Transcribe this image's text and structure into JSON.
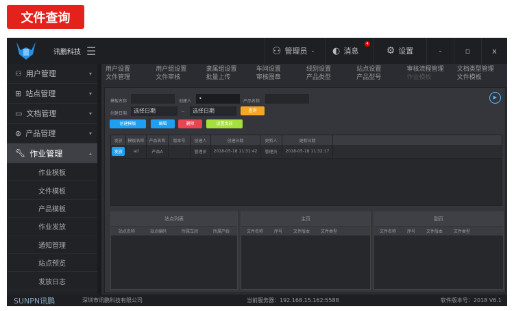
{
  "page_badge": "文件查询",
  "header": {
    "brand": "讯鹏科技",
    "user": "管理员",
    "messages": "消息",
    "message_count": "4",
    "settings": "设置",
    "minimize": "-",
    "restore": "▫",
    "close": "x"
  },
  "sidebar": {
    "items": [
      {
        "label": "用户管理"
      },
      {
        "label": "站点管理"
      },
      {
        "label": "文档管理"
      },
      {
        "label": "产品管理"
      },
      {
        "label": "作业管理"
      }
    ],
    "sub_items": [
      "作业模板",
      "文件模板",
      "产品模板",
      "作业发放",
      "通知管理",
      "站点预览",
      "发放日志"
    ]
  },
  "tabs": {
    "row1": [
      "用户设置",
      "用户组设置",
      "隶属组设置",
      "车间设置",
      "线别设置",
      "站点设置",
      "审核流程管理",
      "文档类型管理"
    ],
    "row2": [
      "文件管理",
      "文件审核",
      "批量上传",
      "审核图章",
      "产品类型",
      "产品型号",
      "作业模板",
      "文件模板"
    ]
  },
  "form": {
    "template_name_label": "模板名称",
    "creator_label": "创建人",
    "creator_value": "•",
    "product_name_label": "产品名称",
    "date_label": "创建日期",
    "date_from": "选择日期",
    "date_sep": "--",
    "date_to": "选择日期",
    "query": "查询"
  },
  "actions": {
    "create": "创建模板",
    "edit": "编辑",
    "delete": "删除",
    "set_distribute": "设置发放"
  },
  "table": {
    "headers": [
      "发放",
      "模板名称",
      "产品名称",
      "版本号",
      "创建人",
      "创建日期",
      "更新人",
      "更新日期"
    ],
    "rows": [
      [
        "发放",
        "ad",
        "产品A",
        "",
        "管理员",
        "2018-05-18 11:31:42",
        "管理员",
        "2018-05-18 11:32:17"
      ]
    ]
  },
  "panels": [
    {
      "title": "站点列表",
      "cols": [
        "站点名称",
        "站点编码",
        "所属车间",
        "所属产线"
      ]
    },
    {
      "title": "主页",
      "cols": [
        "文件名称",
        "序号",
        "文件版本",
        "文件类型"
      ]
    },
    {
      "title": "副页",
      "cols": [
        "文件名称",
        "序号",
        "文件版本",
        "文件类型"
      ]
    }
  ],
  "footer": {
    "logo": "SUNPN讯鹏",
    "company": "深圳市讯鹏科技有限公司",
    "server": "当前服务器：192.168.15.162:5588",
    "version": "软件版本号：2018 V6.1"
  }
}
